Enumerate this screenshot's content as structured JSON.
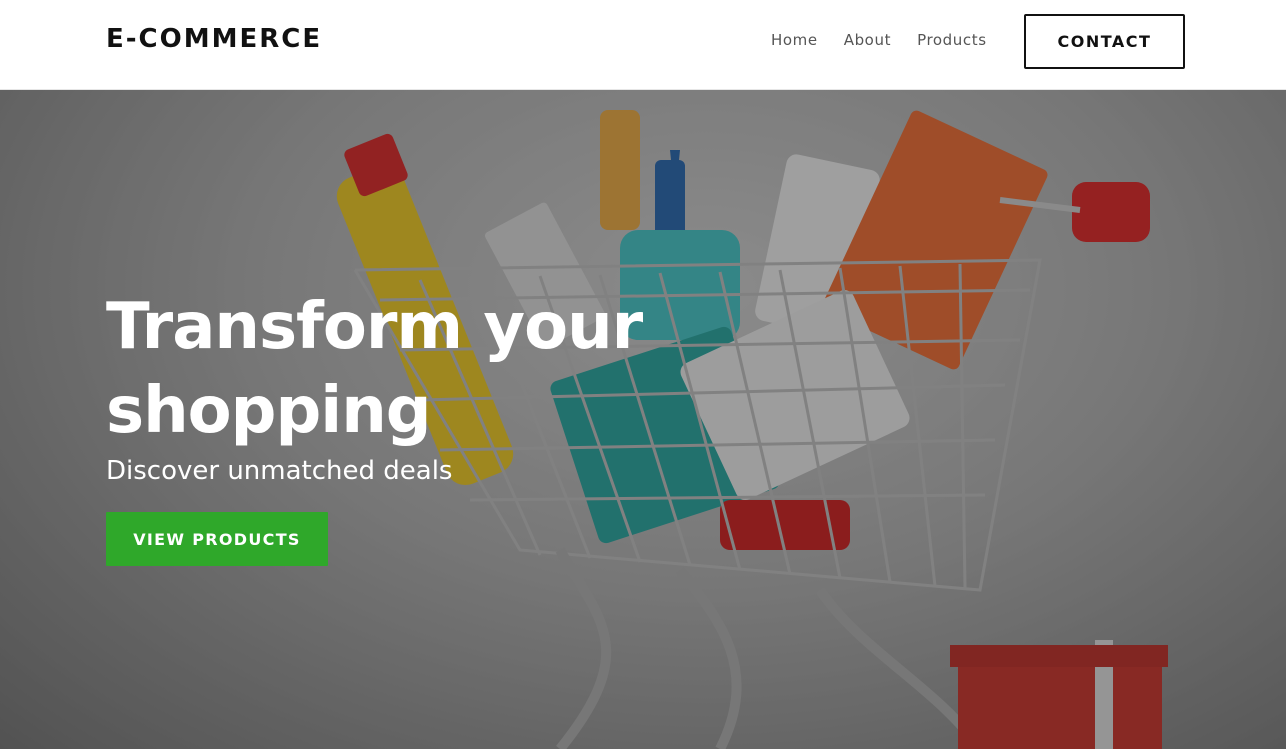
{
  "header": {
    "brand": "E-COMMERCE",
    "nav": [
      {
        "label": "Home"
      },
      {
        "label": "About"
      },
      {
        "label": "Products"
      }
    ],
    "contact_label": "CONTACT"
  },
  "hero": {
    "title": "Transform your shopping",
    "subtitle": "Discover unmatched deals",
    "cta_label": "VIEW PRODUCTS",
    "image": "shopping-cart-with-products-photo"
  },
  "colors": {
    "cta_green": "#2fa82a",
    "text_dark": "#111111",
    "nav_text": "#555555"
  }
}
